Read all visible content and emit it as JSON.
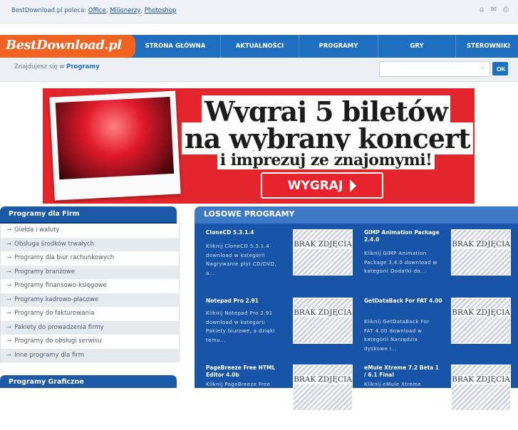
{
  "top": {
    "recommends_prefix": "BestDownload.pl poleca: ",
    "links": [
      "Office",
      "Milionerzy",
      "Photoshop"
    ],
    "icons": [
      "home-icon",
      "mail-icon",
      "print-icon"
    ]
  },
  "logo": {
    "text": "BestDownload.pl"
  },
  "nav": {
    "items": [
      "STRONA GŁÓWNA",
      "AKTUALNOŚCI",
      "PROGRAMY",
      "GRY",
      "STEROWNIKI"
    ]
  },
  "breadcrumb": {
    "prefix": "Znajdujesz się w",
    "current": "Programy"
  },
  "search": {
    "placeholder": "",
    "button": "OK",
    "icon": "search-icon"
  },
  "banner": {
    "line1": "Wygraj 5 biletów",
    "line2": "na wybrany koncert",
    "line3": "i imprezuj ze znajomymi!",
    "button": "WYGRAJ"
  },
  "sidebar": {
    "title": "Programy dla Firm",
    "items": [
      "Giełda i waluty",
      "Obsługa środków trwałych",
      "Programy dla biur rachunkowych",
      "Programy branżowe",
      "Programy finansowo-księgowe",
      "Programy kadrowo-płacowe",
      "Programy do fakturowania",
      "Pakiety do prowadzenia firmy",
      "Programy do obsługi serwisu",
      "Inne programy dla firm"
    ],
    "title2": "Programy Graficzne"
  },
  "random": {
    "title": "LOSOWE PROGRAMY",
    "no_image": "BRAK ZDJĘCIA",
    "programs": [
      {
        "name": "CloneCD 5.3.1.4",
        "desc": "Kliknij CloneCD 5.3.1.4 download w kategorii Nagrywanie płyt CD/DVD, a..."
      },
      {
        "name": "GIMP Animation Package 2.4.0",
        "desc": "Kliknij GIMP Animation Package 2.4.0 download w kategorii Dodatki do..."
      },
      {
        "name": "Notepad Pro 2.91",
        "desc": "Kliknij Notepad Pro 2.91 download w kategorii Pakiety biurowe, a dzięki temu..."
      },
      {
        "name": "GetDataBack For FAT 4.00",
        "desc": "Kliknij GetDataBack For FAT 4.00 download w kategorii Narzędzia dyskowe i..."
      },
      {
        "name": "PageBreeze Free HTML Editor 4.0b",
        "desc": "Kliknij PageBreeze Free"
      },
      {
        "name": "eMule Xtreme 7.2 Beta 1 / 6.1 Final",
        "desc": "Kliknij eMule Xtreme"
      }
    ]
  }
}
